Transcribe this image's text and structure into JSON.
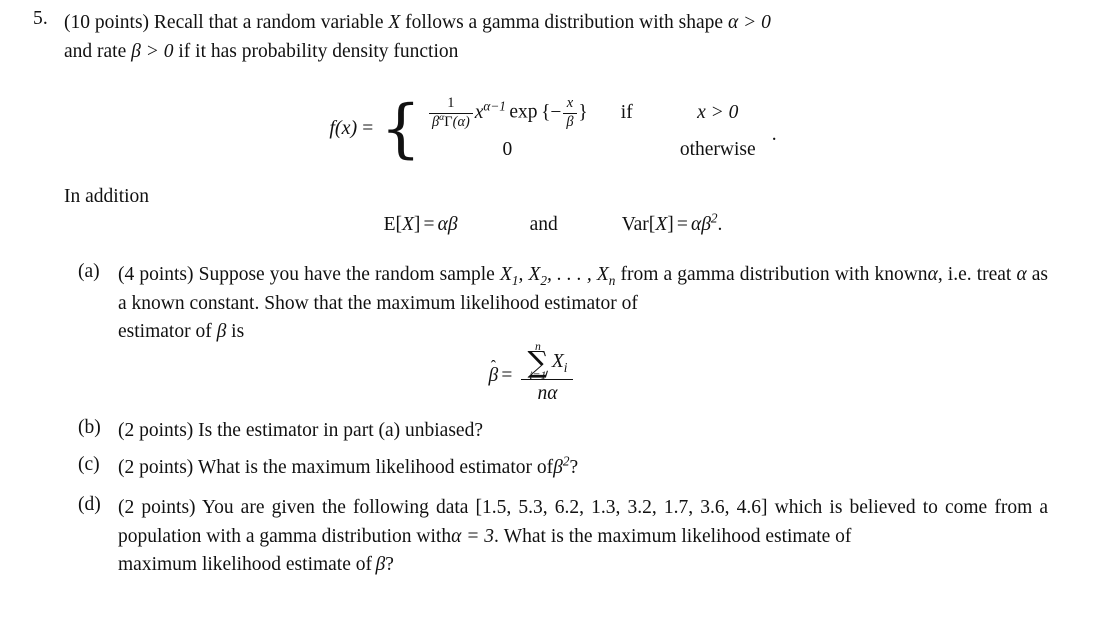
{
  "document": {
    "problem_number": "5.",
    "points_label": "(10 points)",
    "intro_text_1": "Recall that a random variable",
    "intro_var": "X",
    "intro_text_2": "follows a gamma distribution with shape",
    "intro_shape": "α > 0",
    "intro_text_3": "and rate",
    "intro_rate": "β > 0",
    "intro_text_4": "if it has probability density function"
  },
  "pdf_equation": {
    "lhs": "f(x)",
    "equals": "=",
    "case1_value_numerator": "1",
    "case1_value_denominator": "βᵅΓ(α)",
    "case1_power": "xα−1",
    "case1_exp": "exp",
    "case1_exp_arg_num": "x",
    "case1_exp_arg_den": "β",
    "case1_if": "if",
    "case1_condition": "x > 0",
    "case2_value": "0",
    "case2_condition": "otherwise",
    "trailing_punct": "."
  },
  "moments": {
    "lead_in": "In addition",
    "expectation_lhs": "E[X]",
    "expectation_rhs": "αβ",
    "conjunction": "and",
    "variance_lhs": "Var[X]",
    "variance_rhs": "αβ²",
    "trailing_punct": "."
  },
  "parts": [
    {
      "label": "(a)",
      "points": "(4 points)",
      "text_1": "Suppose you have the random sample",
      "sample": "X₁, X₂, … , Xₙ",
      "text_2": "from a gamma distribution with known",
      "alpha": "α",
      "text_3": ", i.e.",
      "text_4": "treat",
      "text_5": "as a known constant.  Show that the maximum likelihood estimator of",
      "beta": "β",
      "text_6": "is"
    },
    {
      "label": "(b)",
      "points": "(2 points)",
      "text": "Is the estimator in part (a) unbiased?"
    },
    {
      "label": "(c)",
      "points": "(2 points)",
      "text_1": "What is the maximum likelihood estimator of",
      "beta_squared": "β²",
      "text_2": "?"
    },
    {
      "label": "(d)",
      "points": "(2 points)",
      "text_1": "You are given the following data",
      "data": "[1.5, 5.3, 6.2, 1.3, 3.2, 1.7, 3.6, 4.6]",
      "text_2": "which is believed to come from a population with a gamma distribution with",
      "alpha_value": "α = 3",
      "text_3": ".  What is the maximum likelihood estimate of",
      "beta": "β",
      "text_4": "?"
    }
  ],
  "mle_equation": {
    "lhs_hat": "̂",
    "lhs_symbol": "β",
    "equals": "=",
    "sum_symbol": "∑",
    "sum_lower": "i=1",
    "sum_upper": "n",
    "sum_term": "X",
    "sum_term_index": "i",
    "denominator": "nα"
  },
  "data_values": [
    1.5,
    5.3,
    6.2,
    1.3,
    3.2,
    1.7,
    3.6,
    4.6
  ],
  "alpha_known": 3,
  "colors": {
    "text": "#111111",
    "background": "#ffffff"
  }
}
